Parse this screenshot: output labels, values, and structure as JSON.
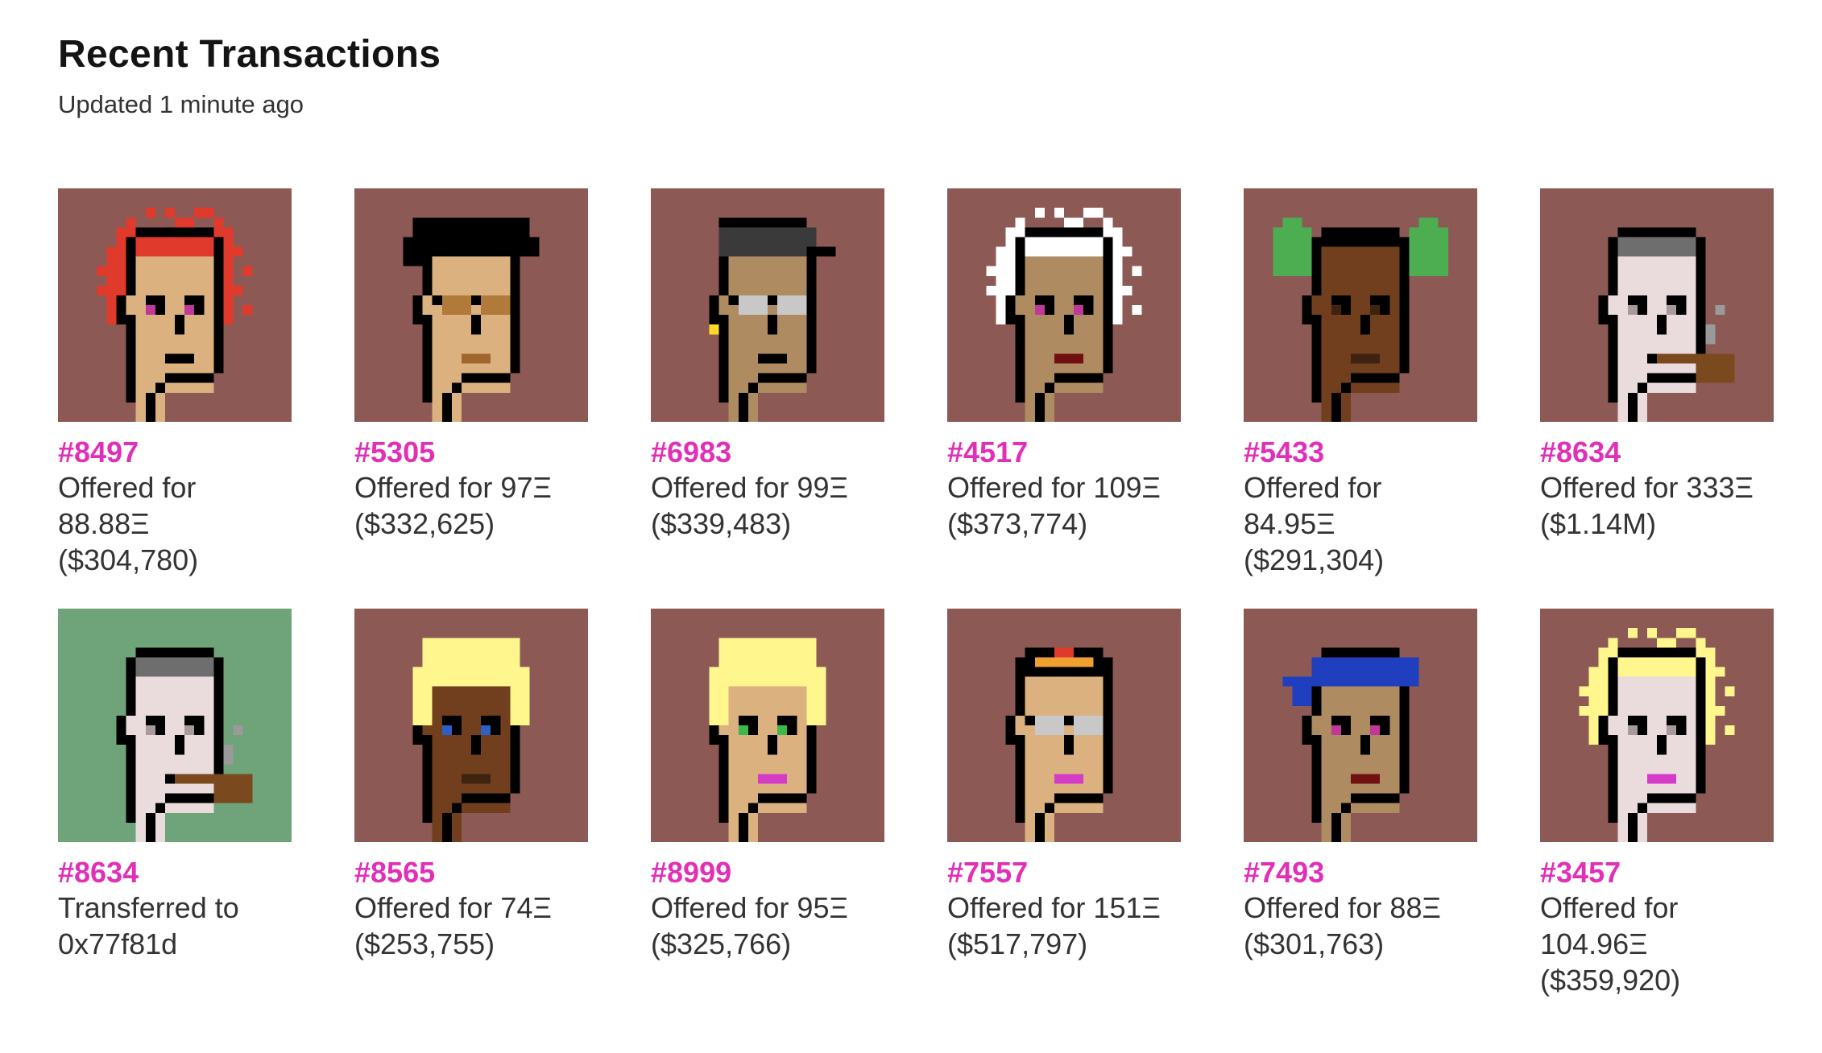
{
  "header": {
    "title": "Recent Transactions",
    "subtitle": "Updated 1 minute ago"
  },
  "transactions": [
    {
      "id": "#8497",
      "line1": "Offered for",
      "line2": "88.88Ξ",
      "line3": "($304,780)",
      "bg": "#8c5954",
      "skin": "#dbb180",
      "hair": "#e03a2c",
      "hair_style": "spiky",
      "eyes": "#c0389a",
      "mouth": "#000000",
      "accessory": "none"
    },
    {
      "id": "#5305",
      "line1": "Offered for 97Ξ",
      "line2": "($332,625)",
      "line3": "",
      "bg": "#8c5954",
      "skin": "#dbb180",
      "hair": "#000000",
      "hair_style": "messy",
      "eyes": "#b07a3a",
      "mouth": "#a0662e",
      "accessory": "glasses"
    },
    {
      "id": "#6983",
      "line1": "Offered for 99Ξ",
      "line2": "($339,483)",
      "line3": "",
      "bg": "#8c5954",
      "skin": "#ae8b61",
      "hair": "#3a3a3a",
      "hair_style": "cap",
      "eyes": "#c8c8c8",
      "mouth": "#000000",
      "accessory": "earring"
    },
    {
      "id": "#4517",
      "line1": "Offered for 109Ξ",
      "line2": "($373,774)",
      "line3": "",
      "bg": "#8c5954",
      "skin": "#ae8b61",
      "hair": "#ffffff",
      "hair_style": "wild",
      "eyes": "#c0389a",
      "mouth": "#711010",
      "accessory": "none"
    },
    {
      "id": "#5433",
      "line1": "Offered for",
      "line2": "84.95Ξ",
      "line3": "($291,304)",
      "bg": "#8c5954",
      "skin": "#713f1d",
      "hair": "#4cae50",
      "hair_style": "clown",
      "eyes": "#3e2410",
      "mouth": "#3e2410",
      "accessory": "none"
    },
    {
      "id": "#8634",
      "line1": "Offered for 333Ξ",
      "line2": "($1.14M)",
      "line3": "",
      "bg": "#8c5954",
      "skin": "#eadcdc",
      "hair": "#6e6e6e",
      "hair_style": "short",
      "eyes": "#a89a9a",
      "mouth": "#000000",
      "accessory": "pipe"
    },
    {
      "id": "#8634",
      "line1": "Transferred to",
      "line2": "0x77f81d",
      "line3": "",
      "bg": "#6fa37a",
      "skin": "#eadcdc",
      "hair": "#6e6e6e",
      "hair_style": "short",
      "eyes": "#a89a9a",
      "mouth": "#000000",
      "accessory": "pipe"
    },
    {
      "id": "#8565",
      "line1": "Offered for 74Ξ",
      "line2": "($253,755)",
      "line3": "",
      "bg": "#8c5954",
      "skin": "#713f1d",
      "hair": "#fff68e",
      "hair_style": "bob",
      "eyes": "#2d5fc4",
      "mouth": "#3e2410",
      "accessory": "none"
    },
    {
      "id": "#8999",
      "line1": "Offered for 95Ξ",
      "line2": "($325,766)",
      "line3": "",
      "bg": "#8c5954",
      "skin": "#dbb180",
      "hair": "#fff68e",
      "hair_style": "bob",
      "eyes": "#3cb84c",
      "mouth": "#d43cc8",
      "accessory": "none"
    },
    {
      "id": "#7557",
      "line1": "Offered for 151Ξ",
      "line2": "($517,797)",
      "line3": "",
      "bg": "#8c5954",
      "skin": "#dbb180",
      "hair": "#000000",
      "hair_style": "tiara",
      "eyes": "#c8c8c8",
      "mouth": "#d43cc8",
      "accessory": "tiara"
    },
    {
      "id": "#7493",
      "line1": "Offered for 88Ξ",
      "line2": "($301,763)",
      "line3": "",
      "bg": "#8c5954",
      "skin": "#ae8b61",
      "hair": "#1f3fbf",
      "hair_style": "bandana",
      "eyes": "#c0389a",
      "mouth": "#711010",
      "accessory": "none"
    },
    {
      "id": "#3457",
      "line1": "Offered for",
      "line2": "104.96Ξ",
      "line3": "($359,920)",
      "bg": "#8c5954",
      "skin": "#eadcdc",
      "hair": "#fff68e",
      "hair_style": "wild",
      "eyes": "#a89a9a",
      "mouth": "#d43cc8",
      "accessory": "none"
    }
  ]
}
